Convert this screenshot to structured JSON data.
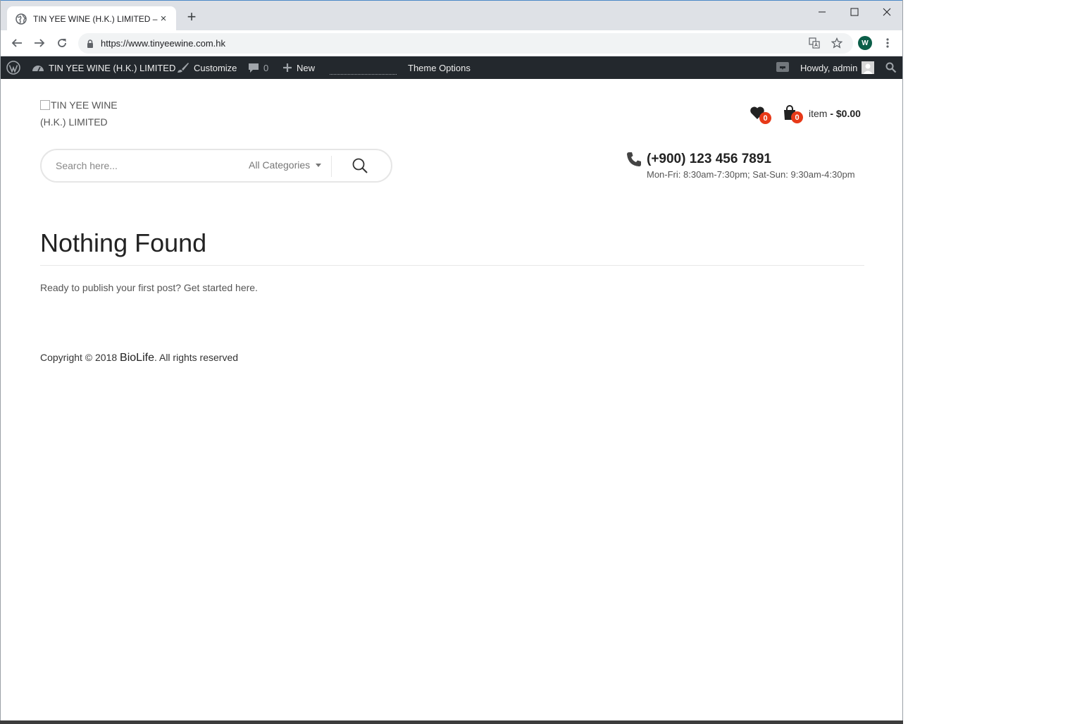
{
  "browser": {
    "tab_title": "TIN YEE WINE (H.K.) LIMITED – 天",
    "tab_close": "×",
    "new_tab": "+",
    "url": "https://www.tinyeewine.com.hk",
    "profile_initial": "W"
  },
  "adminbar": {
    "site_name": "TIN YEE WINE (H.K.) LIMITED",
    "customize": "Customize",
    "comments_count": "0",
    "new_label": "New",
    "theme_options": "Theme Options",
    "howdy": "Howdy, admin"
  },
  "header": {
    "logo_alt": "TIN YEE WINE (H.K.) LIMITED",
    "wishlist_count": "0",
    "cart_count": "0",
    "cart_item_label": "item",
    "cart_total": "- $0.00",
    "search_placeholder": "Search here...",
    "category_select": "All Categories",
    "phone_number": "(+900) 123 456 7891",
    "phone_hours": "Mon-Fri: 8:30am-7:30pm; Sat-Sun: 9:30am-4:30pm"
  },
  "main": {
    "title": "Nothing Found",
    "message": "Ready to publish your first post? Get started here."
  },
  "footer": {
    "copyright_prefix": "Copyright © 2018",
    "brand": "BioLife",
    "copyright_suffix": ". All rights reserved"
  },
  "colors": {
    "adminbar_bg": "#23282d",
    "badge": "#e73918",
    "profile": "#0b5e48"
  }
}
